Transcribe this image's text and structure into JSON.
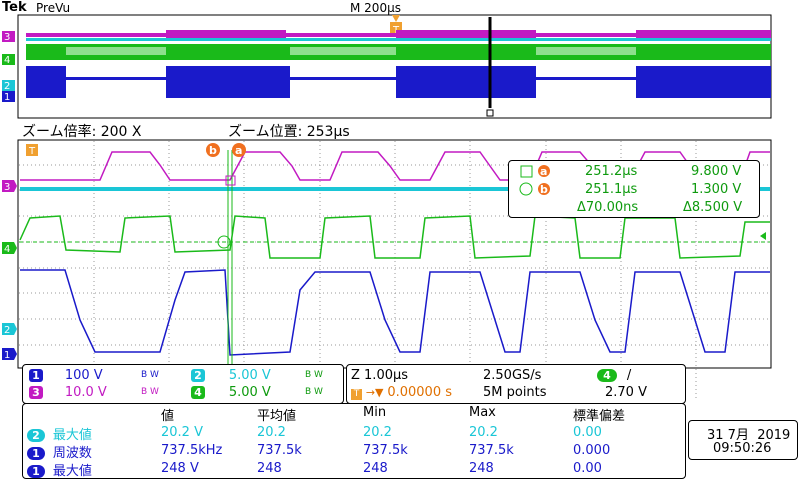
{
  "header": {
    "brand": "Tek",
    "mode": "PreVu",
    "timebase": "M 200µs"
  },
  "zoom": {
    "factor_label": "ズーム倍率: 200 X",
    "position_label": "ズーム位置: 253µs"
  },
  "cursors": {
    "a_time": "251.2µs",
    "a_volt": "9.800 V",
    "b_time": "251.1µs",
    "b_volt": "1.300 V",
    "delta_time": "Δ70.00ns",
    "delta_volt": "Δ8.500 V",
    "a_letter": "a",
    "b_letter": "b"
  },
  "channels": {
    "ch1": {
      "num": "1",
      "scale": "100 V",
      "bw": "B W",
      "color": "#1a1aca"
    },
    "ch2": {
      "num": "2",
      "scale": "5.00 V",
      "bw": "B W",
      "color": "#1ac6d6"
    },
    "ch3": {
      "num": "3",
      "scale": "10.0 V",
      "bw": "B W",
      "color": "#c21ac2"
    },
    "ch4": {
      "num": "4",
      "scale": "5.00 V",
      "bw": "B W",
      "color": "#1aba1a"
    }
  },
  "acquisition": {
    "zoom_time": "Z 1.00µs",
    "sample_rate": "2.50GS/s",
    "trigger_pos": "0.00000 s",
    "record": "5M points",
    "trig_ch": "4",
    "trig_slope": "/",
    "trig_level": "2.70 V"
  },
  "measurements": {
    "headers": [
      "値",
      "平均値",
      "Min",
      "Max",
      "標準偏差"
    ],
    "rows": [
      {
        "ch": "2",
        "name": "最大値",
        "value": "20.2 V",
        "mean": "20.2",
        "min": "20.2",
        "max": "20.2",
        "std": "0.00",
        "color": "#1ac6d6"
      },
      {
        "ch": "1",
        "name": "周波数",
        "value": "737.5kHz",
        "mean": "737.5k",
        "min": "737.5k",
        "max": "737.5k",
        "std": "0.000",
        "color": "#1a1aca"
      },
      {
        "ch": "1",
        "name": "最大値",
        "value": "248 V",
        "mean": "248",
        "min": "248",
        "max": "248",
        "std": "0.00",
        "color": "#1a1aca"
      }
    ]
  },
  "datetime": {
    "date": "31 7月  2019",
    "time": "09:50:26"
  }
}
